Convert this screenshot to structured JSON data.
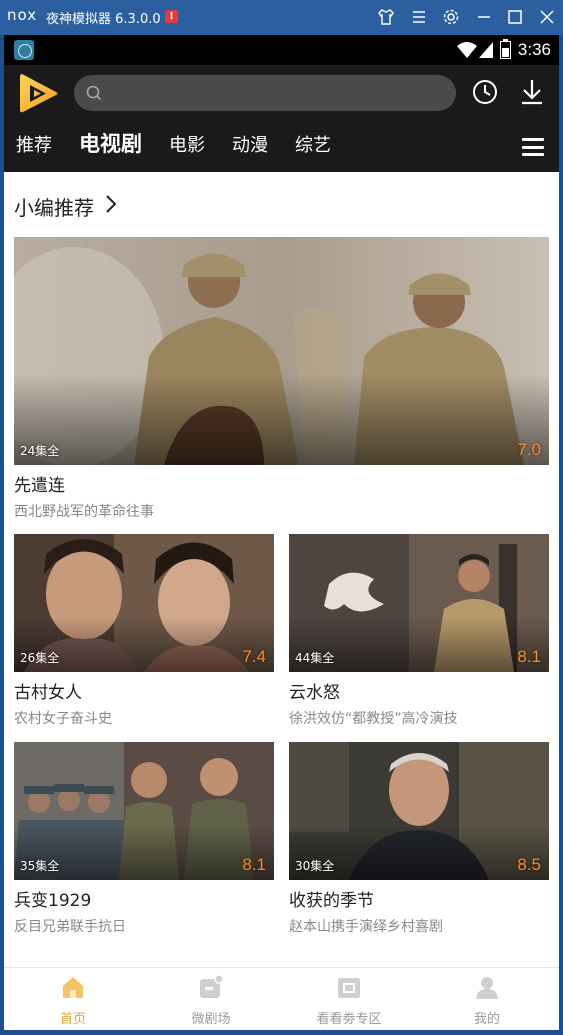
{
  "emulator": {
    "logo": "nox",
    "title": "夜神模拟器 6.3.0.0",
    "alert": "!"
  },
  "status_bar": {
    "time": "3:36"
  },
  "header": {
    "search_placeholder": ""
  },
  "nav": {
    "tabs": [
      {
        "label": "推荐",
        "active": false
      },
      {
        "label": "电视剧",
        "active": true
      },
      {
        "label": "电影",
        "active": false
      },
      {
        "label": "动漫",
        "active": false
      },
      {
        "label": "综艺",
        "active": false
      }
    ]
  },
  "section": {
    "title": "小编推荐"
  },
  "featured": {
    "title": "先遣连",
    "desc": "西北野战军的革命往事",
    "episodes": "24集全",
    "score": "7.0"
  },
  "shows": [
    {
      "title": "古村女人",
      "desc": "农村女子奋斗史",
      "episodes": "26集全",
      "score": "7.4"
    },
    {
      "title": "云水怒",
      "desc": "徐洪效仿“都教授”高冷演技",
      "episodes": "44集全",
      "score": "8.1"
    },
    {
      "title": "兵变1929",
      "desc": "反目兄弟联手抗日",
      "episodes": "35集全",
      "score": "8.1"
    },
    {
      "title": "收获的季节",
      "desc": "赵本山携手演绎乡村喜剧",
      "episodes": "30集全",
      "score": "8.5"
    }
  ],
  "bottom_nav": [
    {
      "label": "首页",
      "icon": "home-icon",
      "active": true
    },
    {
      "label": "微剧场",
      "icon": "mini-theater-icon",
      "active": false
    },
    {
      "label": "看看劵专区",
      "icon": "ticket-icon",
      "active": false
    },
    {
      "label": "我的",
      "icon": "profile-icon",
      "active": false
    }
  ],
  "colors": {
    "accent": "#e0a93a",
    "score": "#ff8a1c",
    "header_bg": "#1a1a1a",
    "emulator_bar": "#2c5fa0"
  }
}
